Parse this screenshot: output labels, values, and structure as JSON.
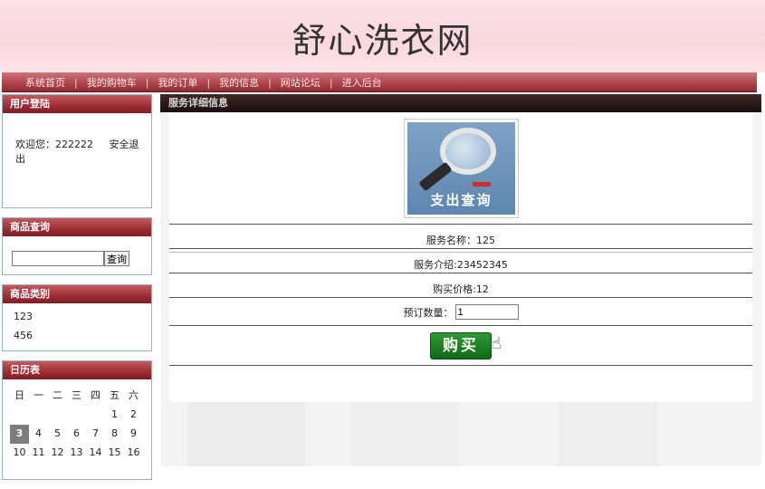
{
  "site": {
    "title": "舒心洗衣网"
  },
  "nav": {
    "items": [
      "系统首页",
      "我的购物车",
      "我的订单",
      "我的信息",
      "网站论坛",
      "进入后台"
    ],
    "separator": "|"
  },
  "login": {
    "title": "用户登陆",
    "welcome": "欢迎您：222222",
    "logout": "安全退出"
  },
  "search": {
    "title": "商品查询",
    "value": "",
    "button": "查询"
  },
  "category": {
    "title": "商品类别",
    "items": [
      "123",
      "456"
    ]
  },
  "calendar": {
    "title": "日历表",
    "weekdays": [
      "日",
      "一",
      "二",
      "三",
      "四",
      "五",
      "六"
    ],
    "rows": [
      [
        "",
        "",
        "",
        "",
        "",
        "1",
        "2"
      ],
      [
        "3",
        "4",
        "5",
        "6",
        "7",
        "8",
        "9"
      ],
      [
        "10",
        "11",
        "12",
        "13",
        "14",
        "15",
        "16"
      ]
    ],
    "today": "3"
  },
  "detail": {
    "title": "服务详细信息",
    "image_text": "支出查询",
    "name": "服务名称：125",
    "intro": "服务介绍:23452345",
    "price": "购买价格:12",
    "qty_label": "预订数量：",
    "qty_value": "1",
    "buy_label": "购买"
  },
  "colors": {
    "header_bg": "#f9d7de",
    "nav_bg": "#b1464d",
    "box_header": "#9b2c33",
    "main_header": "#1a0d0d",
    "buy_button": "#1f8a24"
  },
  "icons": {
    "cursor": "hand-pointer-icon"
  }
}
